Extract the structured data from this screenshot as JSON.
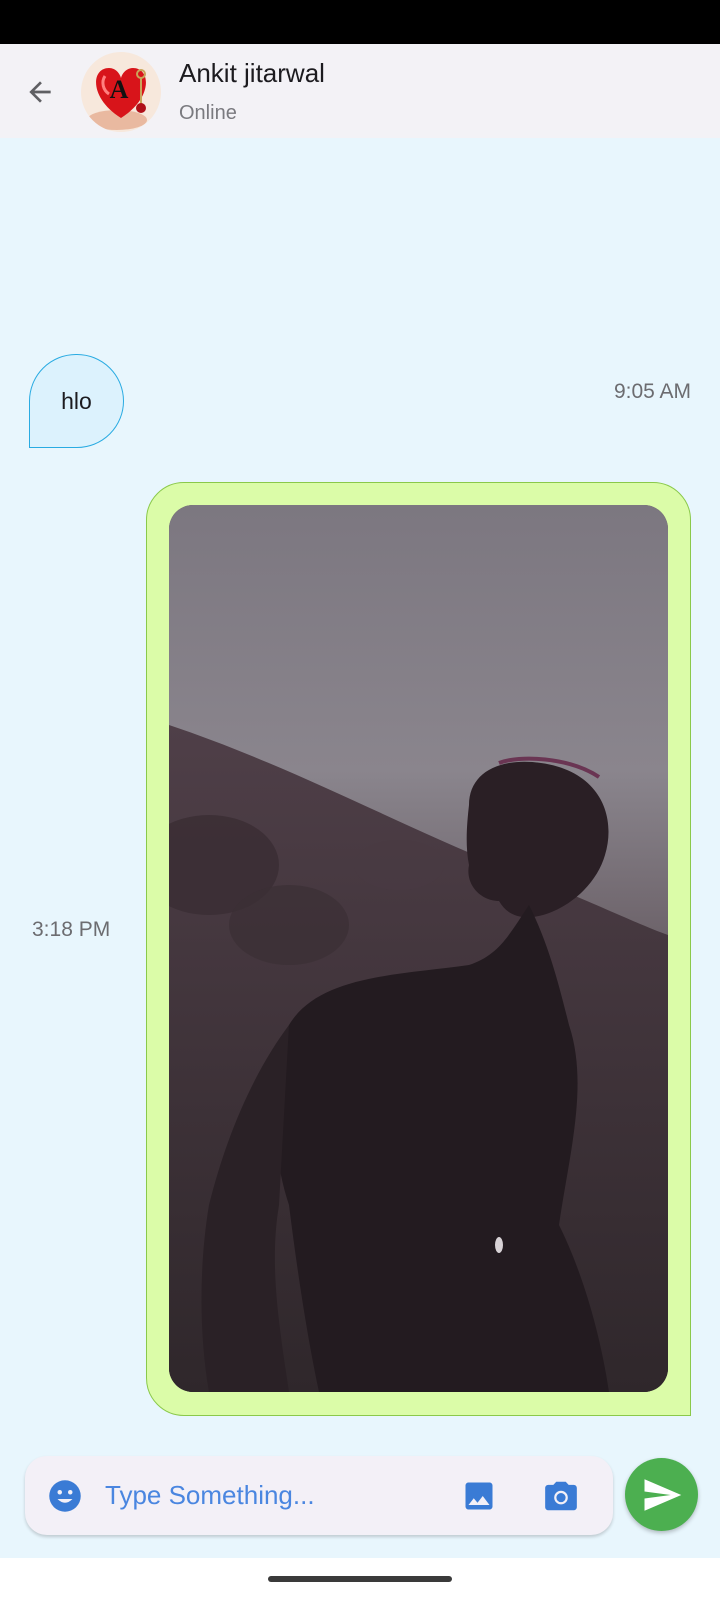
{
  "header": {
    "contact_name": "Ankit jitarwal",
    "contact_status": "Online",
    "avatar_letter": "A"
  },
  "messages": [
    {
      "direction": "received",
      "type": "text",
      "text": "hlo",
      "time": "9:05 AM"
    },
    {
      "direction": "sent",
      "type": "image",
      "image_description": "Man in dark shirt standing on a misty hillside",
      "time": "3:18 PM"
    }
  ],
  "composer": {
    "placeholder": "Type Something...",
    "value": ""
  },
  "icons": {
    "back": "arrow-back-icon",
    "emoji": "emoji-icon",
    "gallery": "image-icon",
    "camera": "camera-icon",
    "send": "send-icon"
  },
  "colors": {
    "chat_background": "#e8f6fd",
    "received_bubble": "#dcf2fd",
    "received_border": "#29abe2",
    "sent_bubble": "#dbfca8",
    "sent_border": "#8ac94a",
    "accent_blue": "#3a7bd5",
    "send_green": "#4caf50"
  }
}
